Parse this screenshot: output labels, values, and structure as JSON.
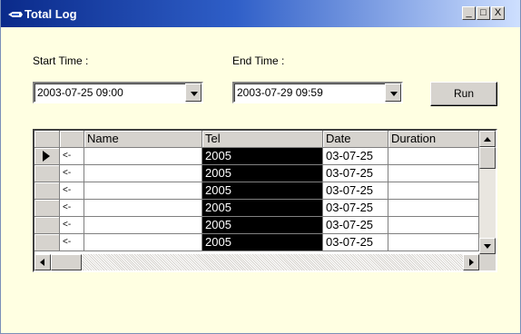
{
  "window": {
    "title": "Total Log"
  },
  "window_controls": {
    "minimize": "_",
    "maximize": "□",
    "close": "X"
  },
  "form": {
    "start_label": "Start Time :",
    "end_label": "End Time :",
    "start_value": "2003-07-25 09:00",
    "end_value": "2003-07-29 09:59",
    "run_label": "Run"
  },
  "grid": {
    "columns": [
      "",
      "",
      "Name",
      "Tel",
      "Date",
      "Duration"
    ],
    "rows": [
      {
        "dir": "<-",
        "name": "",
        "tel": "2005",
        "date": "03-07-25",
        "duration": "",
        "current": true
      },
      {
        "dir": "<-",
        "name": "",
        "tel": "2005",
        "date": "03-07-25",
        "duration": "",
        "current": false
      },
      {
        "dir": "<-",
        "name": "",
        "tel": "2005",
        "date": "03-07-25",
        "duration": "",
        "current": false
      },
      {
        "dir": "<-",
        "name": "",
        "tel": "2005",
        "date": "03-07-25",
        "duration": "",
        "current": false
      },
      {
        "dir": "<-",
        "name": "",
        "tel": "2005",
        "date": "03-07-25",
        "duration": "",
        "current": false
      },
      {
        "dir": "<-",
        "name": "",
        "tel": "2005",
        "date": "03-07-25",
        "duration": "",
        "current": false
      }
    ]
  },
  "icons": {
    "title": "app-pen-icon",
    "current_row": "row-pointer-icon",
    "scroll_up": "scroll-up-icon",
    "scroll_down": "scroll-down-icon",
    "scroll_left": "scroll-left-icon",
    "scroll_right": "scroll-right-icon"
  },
  "colors": {
    "title_start": "#0a2a8a",
    "title_end": "#cfe0ff",
    "form_bg": "#ffffe2",
    "tel_cell_bg": "#000000"
  }
}
